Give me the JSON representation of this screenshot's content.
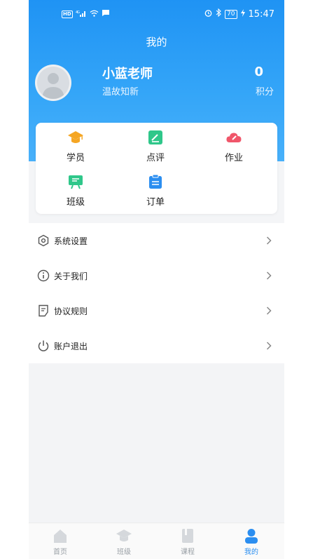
{
  "status_bar": {
    "time": "15:47",
    "battery": "70",
    "network": "4G",
    "hd": "HD"
  },
  "header": {
    "title": "我的"
  },
  "profile": {
    "name": "小蓝老师",
    "motto": "温故知新",
    "points_value": "0",
    "points_label": "积分"
  },
  "quick_actions": [
    {
      "label": "学员",
      "icon": "graduation-cap-icon",
      "color": "#f5a623"
    },
    {
      "label": "点评",
      "icon": "edit-note-icon",
      "color": "#2fc78a"
    },
    {
      "label": "作业",
      "icon": "cloud-pencil-icon",
      "color": "#f0566a"
    },
    {
      "label": "班级",
      "icon": "class-board-icon",
      "color": "#2fc78a"
    },
    {
      "label": "订单",
      "icon": "clipboard-icon",
      "color": "#2b8ef0"
    }
  ],
  "menu": [
    {
      "label": "系统设置",
      "icon": "settings-hexagon-icon"
    },
    {
      "label": "关于我们",
      "icon": "info-circle-icon"
    },
    {
      "label": "协议规则",
      "icon": "document-icon"
    },
    {
      "label": "账户退出",
      "icon": "power-icon"
    }
  ],
  "tabs": [
    {
      "label": "首页",
      "icon": "home-icon",
      "active": false
    },
    {
      "label": "班级",
      "icon": "graduation-cap-icon",
      "active": false
    },
    {
      "label": "课程",
      "icon": "book-icon",
      "active": false
    },
    {
      "label": "我的",
      "icon": "user-icon",
      "active": true
    }
  ],
  "colors": {
    "primary": "#2b8ef0",
    "hero_top": "#1f93f4",
    "hero_bottom": "#4cb3fb"
  }
}
